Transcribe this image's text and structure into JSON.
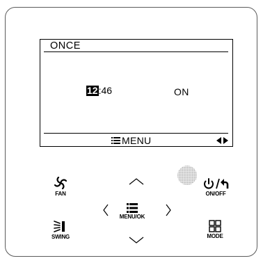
{
  "display": {
    "title": "ONCE",
    "time_hour": "12",
    "time_sep": ":",
    "time_min": "46",
    "state": "ON",
    "menu_label": "MENU"
  },
  "keys": {
    "fan": "FAN",
    "onoff": "ON/OFF",
    "swing": "SWING",
    "mode": "MODE",
    "menuok": "MENU/OK"
  },
  "arrows": {
    "left": "〈",
    "right": "〉"
  },
  "colors": {
    "lcd_border": "#000000",
    "panel_border": "#5a5a5a",
    "sensor": "#bdbdbd"
  },
  "icons": [
    "fan-icon",
    "power-icon",
    "return-icon",
    "swing-icon",
    "mode-grid-icon",
    "menu-list-icon",
    "up-down-arrows-icon",
    "ir-sensor-icon"
  ]
}
